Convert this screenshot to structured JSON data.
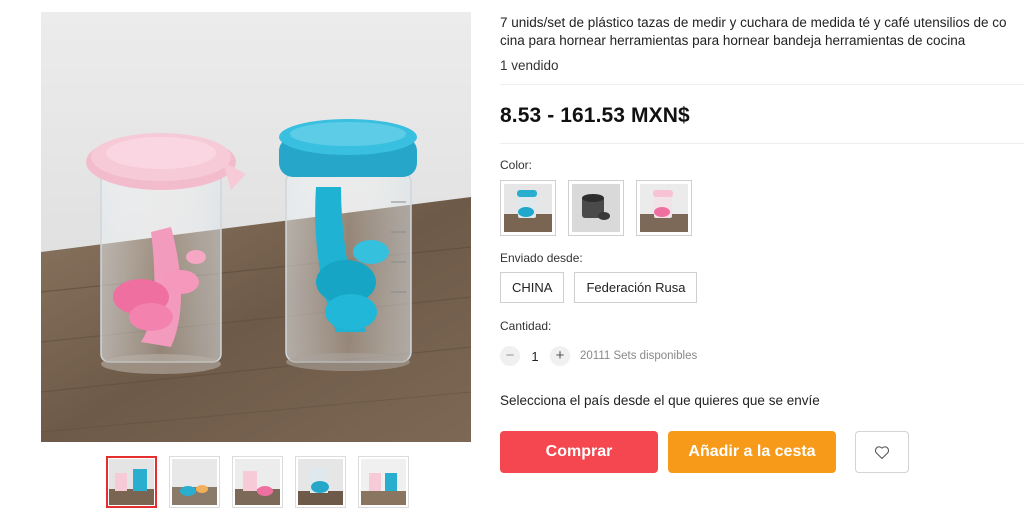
{
  "product": {
    "title_line1": "7 unids/set de plástico tazas de medir y cuchara de medida té y café utensilios de co",
    "title_line2": "cina para hornear herramientas para hornear bandeja herramientas de cocina",
    "sold": "1 vendido",
    "price": "8.53 - 161.53 MXN$"
  },
  "color": {
    "label": "Color:",
    "options": [
      "blue-measuring-set",
      "black-measuring-set",
      "pink-measuring-set"
    ]
  },
  "shipping": {
    "label": "Enviado desde:",
    "options": [
      "CHINA",
      "Federación Rusa"
    ]
  },
  "quantity": {
    "label": "Cantidad:",
    "minus": "−",
    "value": "1",
    "plus": "+",
    "available": "20111 Sets disponibles"
  },
  "select_country": "Selecciona el país desde el que quieres que se envíe",
  "actions": {
    "buy": "Comprar",
    "add_to_cart": "Añadir a la cesta",
    "wishlist_icon": "heart-icon"
  },
  "colors": {
    "buy": "#f5474f",
    "cart": "#f79a1a",
    "active_thumb": "#e62e2e"
  }
}
